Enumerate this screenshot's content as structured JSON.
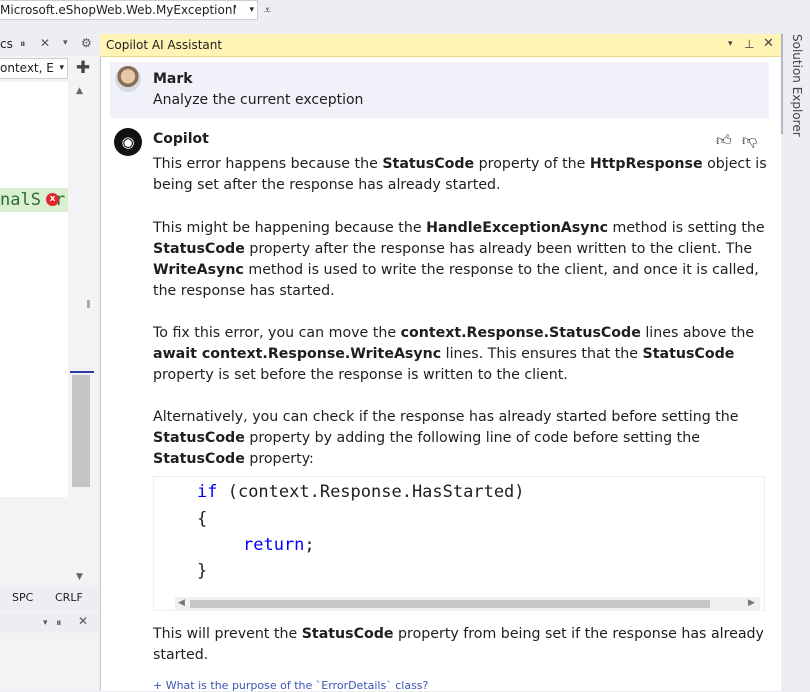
{
  "toolbar": {
    "solution_combo": "Microsoft.eShopWeb.Web.MyExceptionMi",
    "combo_arrow": "▾",
    "extra_glyph": "⩡"
  },
  "left_panel": {
    "tab_title": "cs",
    "pin": "⏸",
    "close": "✕",
    "dropdown": "▾",
    "gear": "⚙",
    "combo_value": "ontext, E",
    "add": "✚",
    "code_fragment": "nalS",
    "code_fragment_tail": "r",
    "status_spc": "SPC",
    "status_crlf": "CRLF"
  },
  "copilot_panel": {
    "title": "Copilot AI Assistant",
    "controls": {
      "dropdown": "▾",
      "pin": "⊥",
      "close": "✕"
    },
    "user_message": {
      "name": "Mark",
      "text": "Analyze the current exception"
    },
    "assistant": {
      "name": "Copilot",
      "icon": "robot-icon",
      "paragraphs": {
        "p1_a": "This error happens because the ",
        "p1_b": "StatusCode",
        "p1_c": " property of the ",
        "p1_d": "HttpResponse",
        "p1_e": " object is being set after the response has already started.",
        "p2_a": "This might be happening because the ",
        "p2_b": "HandleExceptionAsync",
        "p2_c": " method is setting the ",
        "p2_d": "StatusCode",
        "p2_e": " property after the response has already been written to the client. The ",
        "p2_f": "WriteAsync",
        "p2_g": " method is used to write the response to the client, and once it is called, the response has started.",
        "p3_a": "To fix this error, you can move the ",
        "p3_b": "context.Response.StatusCode",
        "p3_c": " lines above the ",
        "p3_d": "await context.Response.WriteAsync",
        "p3_e": " lines. This ensures that the ",
        "p3_f": "StatusCode",
        "p3_g": " property is set before the response is written to the client.",
        "p4_a": "Alternatively, you can check if the response has already started before setting the ",
        "p4_b": "StatusCode",
        "p4_c": " property by adding the following line of code before setting the ",
        "p4_d": "StatusCode",
        "p4_e": " property:",
        "p5_a": "This will prevent the ",
        "p5_b": "StatusCode",
        "p5_c": " property from being set if the response has already started."
      },
      "code": {
        "line1_kw": "if",
        "line1_rest": " (context.Response.HasStarted)",
        "line2": "{",
        "line3_kw": "return",
        "line3_rest": ";",
        "line4": "}"
      },
      "suggestion": "+ What is the purpose of the `ErrorDetails` class?"
    }
  },
  "right_strip": {
    "solution_explorer_label": "Solution Explorer"
  },
  "colors": {
    "title_bar": "#fff3b5",
    "keyword": "#0000ff",
    "user_bubble": "#f1f1f9",
    "accent_marker": "#2c3ba6"
  }
}
